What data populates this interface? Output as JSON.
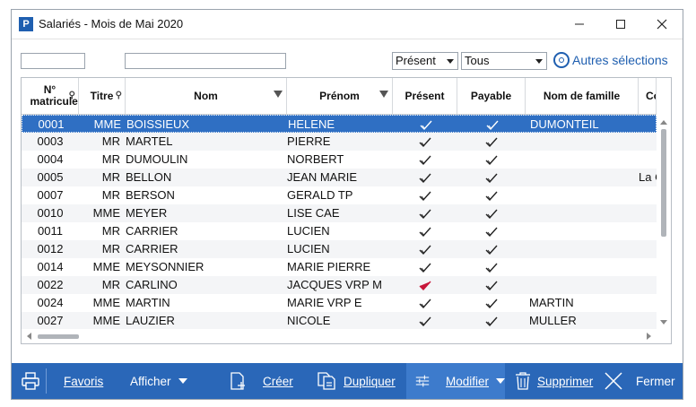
{
  "window": {
    "app_icon": "P",
    "title": "Salariés - Mois de Mai 2020",
    "minimize_icon": "minimize-icon",
    "maximize_icon": "maximize-icon",
    "close_icon": "close-icon"
  },
  "filters": {
    "matricule_value": "",
    "nom_value": "",
    "present_select": "Présent",
    "tous_select": "Tous",
    "autres_selections": "Autres sélections"
  },
  "grid": {
    "columns": {
      "matricule": "N° matricule",
      "titre": "Titre",
      "nom": "Nom",
      "prenom": "Prénom",
      "present": "Présent",
      "payable": "Payable",
      "nom_famille": "Nom de famille",
      "co": "Co"
    },
    "rows": [
      {
        "matricule": "0001",
        "titre": "MME",
        "nom": "BOISSIEUX",
        "prenom": "HELENE",
        "present": "checked",
        "payable": "checked",
        "nom_famille": "DUMONTEIL",
        "co": ""
      },
      {
        "matricule": "0003",
        "titre": "MR",
        "nom": "MARTEL",
        "prenom": "PIERRE",
        "present": "checked",
        "payable": "checked",
        "nom_famille": "",
        "co": ""
      },
      {
        "matricule": "0004",
        "titre": "MR",
        "nom": "DUMOULIN",
        "prenom": "NORBERT",
        "present": "checked",
        "payable": "checked",
        "nom_famille": "",
        "co": ""
      },
      {
        "matricule": "0005",
        "titre": "MR",
        "nom": "BELLON",
        "prenom": "JEAN MARIE",
        "present": "checked",
        "payable": "checked",
        "nom_famille": "",
        "co": "La C"
      },
      {
        "matricule": "0007",
        "titre": "MR",
        "nom": "BERSON",
        "prenom": "GERALD TP",
        "present": "checked",
        "payable": "checked",
        "nom_famille": "",
        "co": ""
      },
      {
        "matricule": "0010",
        "titre": "MME",
        "nom": "MEYER",
        "prenom": "LISE CAE",
        "present": "checked",
        "payable": "checked",
        "nom_famille": "",
        "co": ""
      },
      {
        "matricule": "0011",
        "titre": "MR",
        "nom": "CARRIER",
        "prenom": "LUCIEN",
        "present": "checked",
        "payable": "checked",
        "nom_famille": "",
        "co": ""
      },
      {
        "matricule": "0012",
        "titre": "MR",
        "nom": "CARRIER",
        "prenom": "LUCIEN",
        "present": "checked",
        "payable": "checked",
        "nom_famille": "",
        "co": ""
      },
      {
        "matricule": "0014",
        "titre": "MME",
        "nom": "MEYSONNIER",
        "prenom": "MARIE PIERRE",
        "present": "checked",
        "payable": "checked",
        "nom_famille": "",
        "co": ""
      },
      {
        "matricule": "0022",
        "titre": "MR",
        "nom": "CARLINO",
        "prenom": "JACQUES VRP M",
        "present": "checked-red",
        "payable": "checked",
        "nom_famille": "",
        "co": ""
      },
      {
        "matricule": "0024",
        "titre": "MME",
        "nom": "MARTIN",
        "prenom": "MARIE VRP E",
        "present": "checked",
        "payable": "checked",
        "nom_famille": "MARTIN",
        "co": ""
      },
      {
        "matricule": "0027",
        "titre": "MME",
        "nom": "LAUZIER",
        "prenom": "NICOLE",
        "present": "checked",
        "payable": "checked",
        "nom_famille": "MULLER",
        "co": ""
      }
    ]
  },
  "toolbar": {
    "print_icon": "printer-icon",
    "favoris": "Favoris",
    "afficher": "Afficher",
    "creer": "Créer",
    "dupliquer": "Dupliquer",
    "modifier": "Modifier",
    "supprimer": "Supprimer",
    "fermer": "Fermer"
  },
  "colors": {
    "accent": "#2a67b8",
    "selection": "#2f6fc3",
    "check_red": "#c8163a",
    "link_blue": "#1f5fb0"
  }
}
